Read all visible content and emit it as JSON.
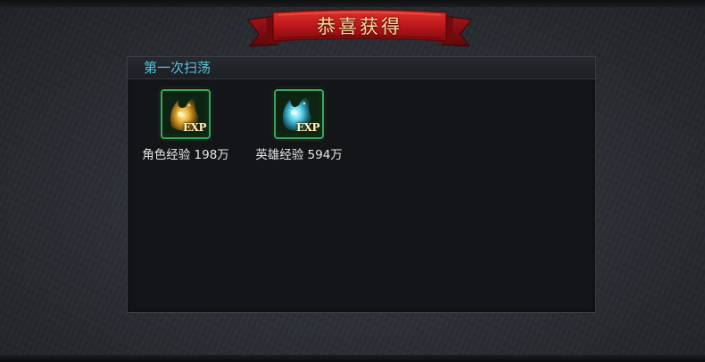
{
  "banner": {
    "title": "恭喜获得"
  },
  "panel": {
    "title": "第一次扫荡"
  },
  "rewards": [
    {
      "icon": "exp-gold-icon",
      "icon_label": "EXP",
      "name": "角色经验",
      "amount": "198万",
      "caption": "角色经验 198万",
      "color": "#e0b030"
    },
    {
      "icon": "exp-blue-icon",
      "icon_label": "EXP",
      "name": "英雄经验",
      "amount": "594万",
      "caption": "英雄经验 594万",
      "color": "#4ec8e0"
    }
  ],
  "colors": {
    "ribbon": "#c0191a",
    "title_text": "#f7df9a",
    "panel_title": "#59c2e0",
    "icon_border": "#3fa463"
  }
}
